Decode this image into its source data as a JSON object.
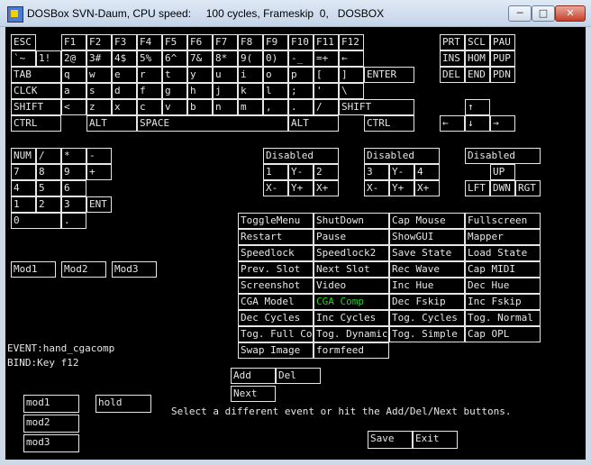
{
  "window": {
    "title": "DOSBox SVN-Daum, CPU speed:     100 cycles, Frameskip  0,   DOSBOX",
    "minimize_label": "─",
    "maximize_label": "□",
    "close_label": "✕"
  },
  "keyboard": {
    "rows": [
      [
        "ESC",
        "F1",
        "F2",
        "F3",
        "F4",
        "F5",
        "F6",
        "F7",
        "F8",
        "F9",
        "F10",
        "F11",
        "F12"
      ],
      [
        "`~",
        "1!",
        "2@",
        "3#",
        "4$",
        "5%",
        "6^",
        "7&",
        "8*",
        "9(",
        "0)",
        "-_",
        "=+",
        "←"
      ],
      [
        "TAB",
        "q",
        "w",
        "e",
        "r",
        "t",
        "y",
        "u",
        "i",
        "o",
        "p",
        "[",
        "]",
        "ENTER"
      ],
      [
        "CLCK",
        "a",
        "s",
        "d",
        "f",
        "g",
        "h",
        "j",
        "k",
        "l",
        ";",
        "'",
        "\\"
      ],
      [
        "SHIFT",
        "<",
        "z",
        "x",
        "c",
        "v",
        "b",
        "n",
        "m",
        ",",
        ".",
        "/",
        "SHIFT"
      ],
      [
        "CTRL",
        "ALT",
        "SPACE",
        "ALT",
        "CTRL"
      ]
    ],
    "nav": [
      [
        "PRT",
        "SCL",
        "PAU"
      ],
      [
        "INS",
        "HOM",
        "PUP"
      ],
      [
        "DEL",
        "END",
        "PDN"
      ]
    ],
    "arrows": [
      "↑",
      "←",
      "↓",
      "→"
    ],
    "numpad": [
      [
        "NUM",
        "/",
        "*",
        "-"
      ],
      [
        "7",
        "8",
        "9",
        "+"
      ],
      [
        "4",
        "5",
        "6"
      ],
      [
        "1",
        "2",
        "3",
        "ENT"
      ],
      [
        "0",
        "."
      ]
    ]
  },
  "joysticks": {
    "stick1": {
      "status": "Disabled",
      "labels": [
        "1",
        "Y-",
        "2",
        "X-",
        "Y+",
        "X+"
      ]
    },
    "stick2": {
      "status": "Disabled",
      "labels": [
        "3",
        "Y-",
        "4",
        "X-",
        "Y+",
        "X+"
      ]
    },
    "hat": {
      "status": "Disabled",
      "labels": [
        "UP",
        "LFT",
        "DWN",
        "RGT"
      ]
    }
  },
  "mods": [
    "Mod1",
    "Mod2",
    "Mod3"
  ],
  "events": [
    [
      "ToggleMenu",
      "ShutDown",
      "Cap Mouse",
      "Fullscreen"
    ],
    [
      "Restart",
      "Pause",
      "ShowGUI",
      "Mapper"
    ],
    [
      "Speedlock",
      "Speedlock2",
      "Save State",
      "Load State"
    ],
    [
      "Prev. Slot",
      "Next Slot",
      "Rec Wave",
      "Cap MIDI"
    ],
    [
      "Screenshot",
      "Video",
      "Inc Hue",
      "Dec Hue"
    ],
    [
      "CGA Model",
      "CGA Comp",
      "Dec Fskip",
      "Inc Fskip"
    ],
    [
      "Dec Cycles",
      "Inc Cycles",
      "Tog. Cycles",
      "Tog. Normal Core"
    ],
    [
      "Tog. Full Core",
      "Tog. Dynamic",
      "Tog. Simple",
      "Cap OPL"
    ],
    [
      "Swap Image",
      "formfeed"
    ]
  ],
  "selected_event": "CGA Comp",
  "status": {
    "event": "EVENT:hand_cgacomp",
    "bind": "BIND:Key f12",
    "hint": "Select a different event or hit the Add/Del/Next buttons."
  },
  "bind_buttons": {
    "add": "Add",
    "del": "Del",
    "next": "Next"
  },
  "modifiers": [
    "mod1",
    "mod2",
    "mod3"
  ],
  "hold_label": "hold",
  "save_label": "Save",
  "exit_label": "Exit",
  "colors": {
    "screen": "#000000",
    "text": "#e6e6e6",
    "highlight": "#1fd41f"
  }
}
